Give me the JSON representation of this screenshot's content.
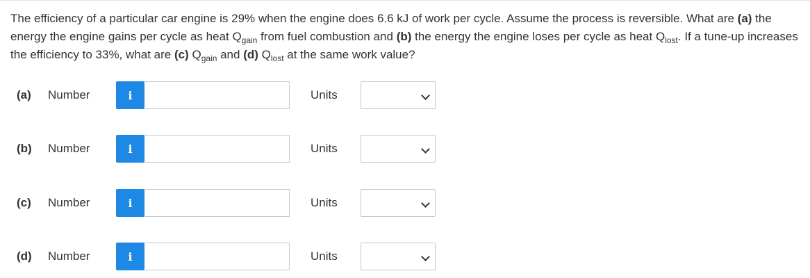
{
  "question": {
    "seg1": "The efficiency of a particular car engine is 29% when the engine does 6.6 kJ of work per cycle. Assume the process is reversible. What are ",
    "part_a": "(a)",
    "seg2": " the energy the engine gains per cycle as heat ",
    "q_gain_1": "Q",
    "q_gain_1_sub": "gain",
    "seg3": " from fuel combustion and ",
    "part_b": "(b)",
    "seg4": " the energy the engine loses per cycle as heat ",
    "q_lost_1": "Q",
    "q_lost_1_sub": "lost",
    "seg5": ". If a tune-up increases the efficiency to 33%, what are ",
    "part_c": "(c)",
    "seg6": " ",
    "q_gain_2": "Q",
    "q_gain_2_sub": "gain",
    "seg7": " and ",
    "part_d": "(d)",
    "seg8": " ",
    "q_lost_2": "Q",
    "q_lost_2_sub": "lost",
    "seg9": " at the same work value?"
  },
  "rows": [
    {
      "part": "(a)",
      "number_label": "Number",
      "info": "i",
      "value": "",
      "units_label": "Units",
      "units_value": ""
    },
    {
      "part": "(b)",
      "number_label": "Number",
      "info": "i",
      "value": "",
      "units_label": "Units",
      "units_value": ""
    },
    {
      "part": "(c)",
      "number_label": "Number",
      "info": "i",
      "value": "",
      "units_label": "Units",
      "units_value": ""
    },
    {
      "part": "(d)",
      "number_label": "Number",
      "info": "i",
      "value": "",
      "units_label": "Units",
      "units_value": ""
    }
  ],
  "colors": {
    "info_button": "#1e88e5",
    "text": "#333333",
    "border": "#c8c8c8"
  }
}
